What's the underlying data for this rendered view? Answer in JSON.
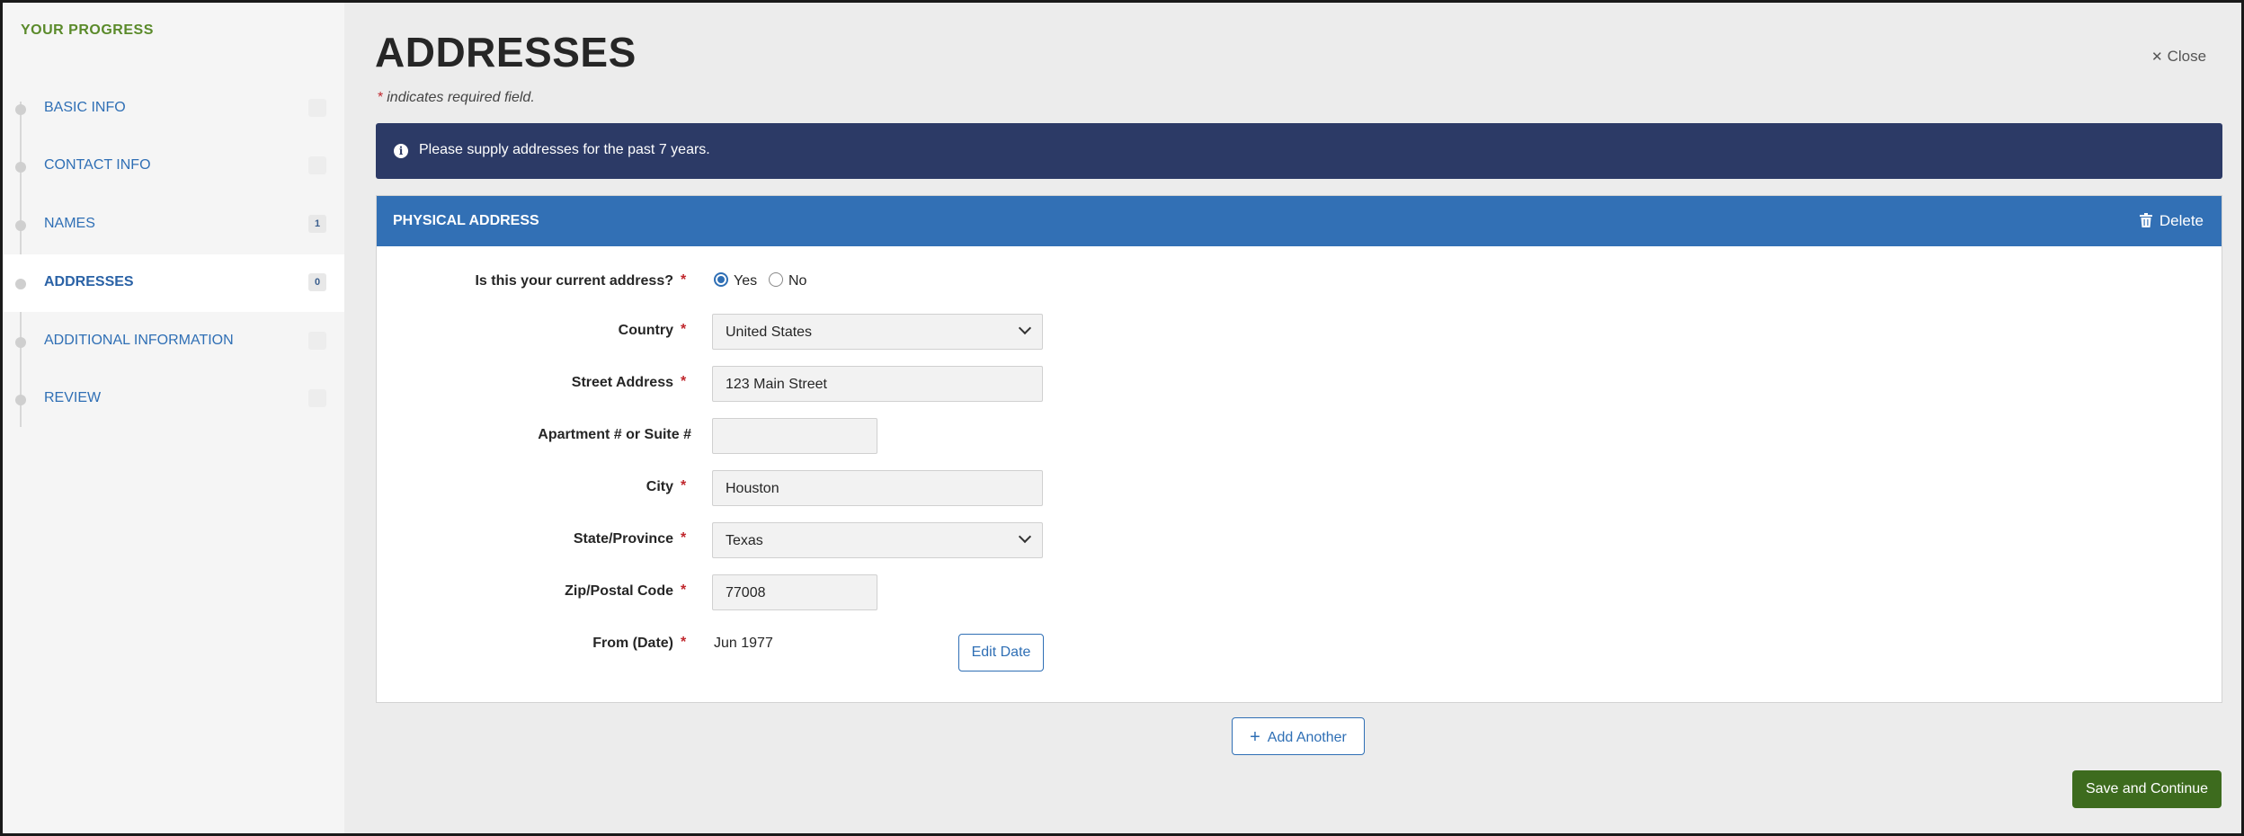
{
  "sidebar": {
    "title": "YOUR PROGRESS",
    "items": [
      {
        "label": "BASIC INFO",
        "badge": ""
      },
      {
        "label": "CONTACT INFO",
        "badge": ""
      },
      {
        "label": "NAMES",
        "badge": "1"
      },
      {
        "label": "ADDRESSES",
        "badge": "0"
      },
      {
        "label": "ADDITIONAL INFORMATION",
        "badge": ""
      },
      {
        "label": "REVIEW",
        "badge": ""
      }
    ],
    "active": "ADDRESSES"
  },
  "header": {
    "title": "ADDRESSES",
    "close_label": "Close",
    "required_note": "indicates required field."
  },
  "banner": {
    "text": "Please supply addresses for the past 7 years."
  },
  "card": {
    "title": "PHYSICAL ADDRESS",
    "delete_label": "Delete"
  },
  "form": {
    "current_address": {
      "label": "Is this your current address?",
      "options": [
        "Yes",
        "No"
      ],
      "selected": "Yes"
    },
    "country": {
      "label": "Country",
      "value": "United States"
    },
    "street": {
      "label": "Street Address",
      "value": "123 Main Street"
    },
    "apartment": {
      "label": "Apartment # or Suite #",
      "value": ""
    },
    "city": {
      "label": "City",
      "value": "Houston"
    },
    "state": {
      "label": "State/Province",
      "value": "Texas"
    },
    "zip": {
      "label": "Zip/Postal Code",
      "value": "77008"
    },
    "from_date": {
      "label": "From (Date)",
      "value": "Jun 1977",
      "edit_label": "Edit Date"
    }
  },
  "actions": {
    "add_another": "Add Another",
    "save_continue": "Save and Continue"
  },
  "colors": {
    "banner": "#2c3a66",
    "card_header": "#3270b5",
    "save_button": "#3d6b1e",
    "required": "#c0272d",
    "progress_title": "#5a8a2a"
  }
}
